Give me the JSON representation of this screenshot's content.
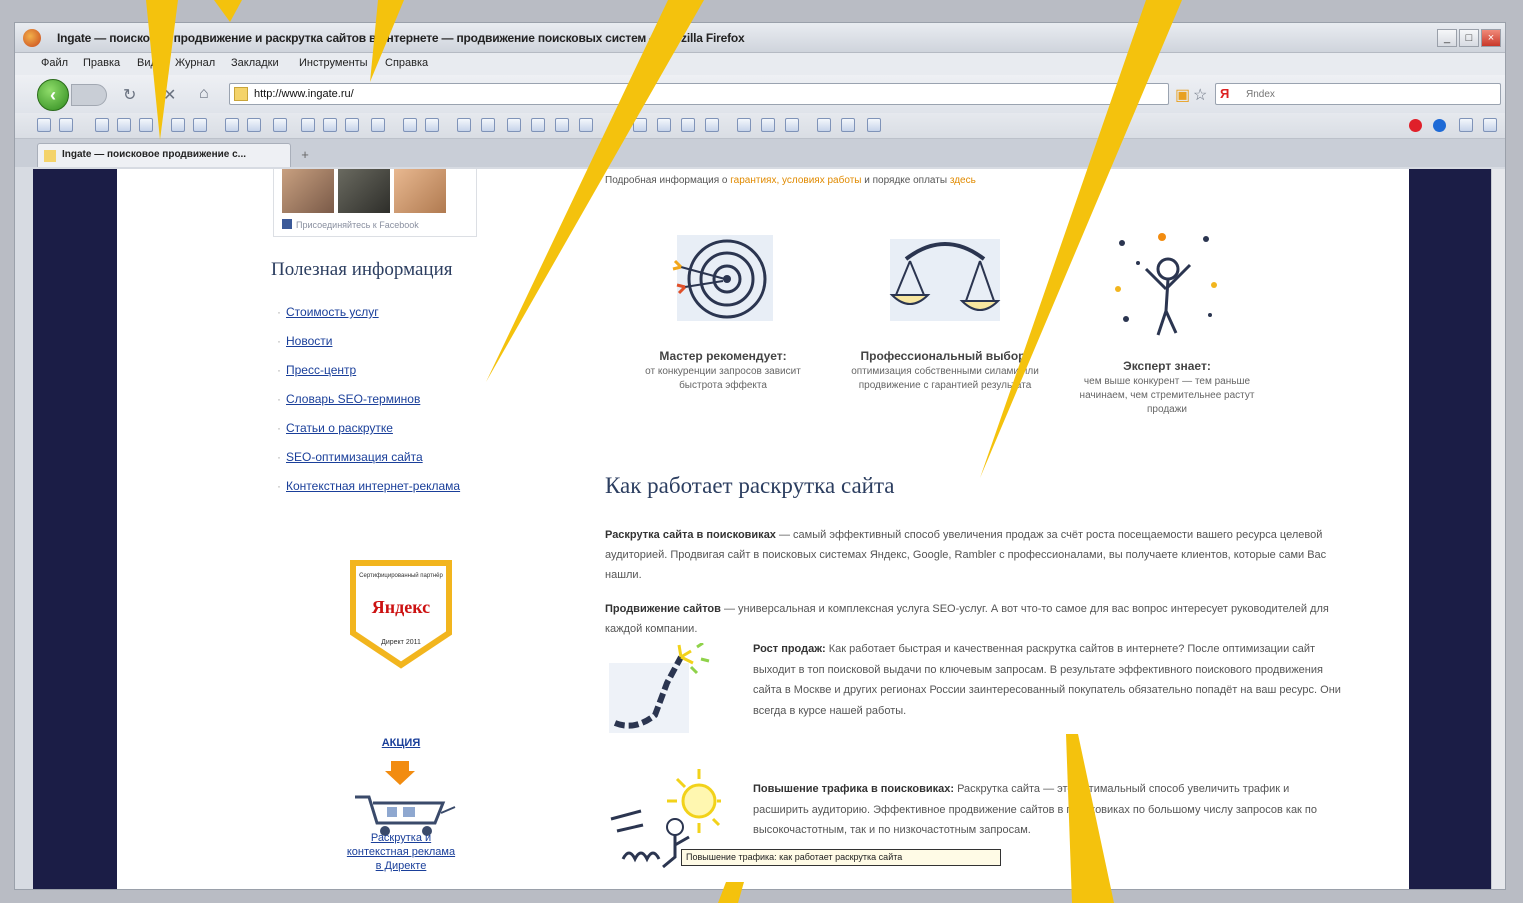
{
  "window": {
    "title": "Ingate — поисковое продвижение и раскрутка сайтов в интернете — продвижение поисковых систем — Mozilla Firefox",
    "controls": {
      "minimize": "_",
      "maximize": "□",
      "close": "×"
    }
  },
  "menu": [
    "Файл",
    "Правка",
    "Вид",
    "Журнал",
    "Закладки",
    "Инструменты",
    "Справка"
  ],
  "navigation": {
    "back_icon": "back-arrow-icon",
    "url": "http://www.ingate.ru/",
    "search_placeholder": "Яndex"
  },
  "tabs": [
    {
      "label": "Ingate — поисковое продвижение с..."
    }
  ],
  "sidebar": {
    "facebook_text": "Присоединяйтесь к Facebook",
    "useful_title": "Полезная информация",
    "useful_links": [
      "Стоимость услуг",
      "Новости",
      "Пресс-центр",
      "Словарь SEO-терминов",
      "Статьи о раскрутке",
      "SEO-оптимизация сайта",
      "Контекстная интернет-реклама"
    ],
    "badge": {
      "top_text": "Сертифицированный партнёр",
      "brand": "Яндекс",
      "bottom_text": "Директ",
      "year": "2011"
    },
    "promo": {
      "label": "АКЦИЯ",
      "link_text": "Раскрутка и контекстная реклама в Директе"
    }
  },
  "main": {
    "intro": {
      "text_before": "Подробная информация о ",
      "highlight": "гарантиях, условиях работы",
      "text_middle": " и порядке оплаты ",
      "highlight2": "здесь"
    },
    "features": [
      {
        "title": "Мастер рекомендует:",
        "desc": "от конкуренции запросов зависит быстрота эффекта"
      },
      {
        "title": "Профессиональный выбор:",
        "desc": "оптимизация собственными силами или продвижение с гарантией результата"
      },
      {
        "title": "Эксперт знает:",
        "desc": "чем выше конкурент — тем раньше начинаем, чем стремительнее растут продажи"
      }
    ],
    "how_title": "Как работает раскрутка сайта",
    "p1_bold": "Раскрутка сайта в поисковиках",
    "p1_text": " — самый эффективный способ увеличения продаж за счёт роста посещаемости вашего ресурса целевой аудиторией. Продвигая сайт в поисковых системах Яндекс, Google, Rambler с профессионалами, вы получаете клиентов, которые сами Вас нашли.",
    "p2_bold": "Продвижение сайтов",
    "p2_text": " — универсальная и комплексная услуга SEO-услуг. А вот что-то самое для вас вопрос интересует руководителей для каждой компании.",
    "p3_bold": "Рост продаж:",
    "p3_text": " Как работает быстрая и качественная раскрутка сайтов в интернете? После оптимизации сайт выходит в топ поисковой выдачи по ключевым запросам. В результате эффективного поискового продвижения сайта в Москве и других регионах России заинтересованный покупатель обязательно попадёт на ваш ресурс. Они всегда в курсе нашей работы.",
    "p4_bold": "Повышение трафика в поисковиках:",
    "p4_text": " Раскрутка сайта — это оптимальный способ увеличить трафик и расширить аудиторию. Эффективное продвижение сайтов в поисковиках по большому числу запросов как по высокочастотным, так и по низкочастотным запросам.",
    "tooltip": "Повышение трафика: как работает раскрутка сайта"
  },
  "colors": {
    "ray": "#f4c20d",
    "viewport_bg": "#1b1d46",
    "link": "#1a3f9a",
    "heading": "#2c3e60",
    "accent": "#e08a00"
  }
}
